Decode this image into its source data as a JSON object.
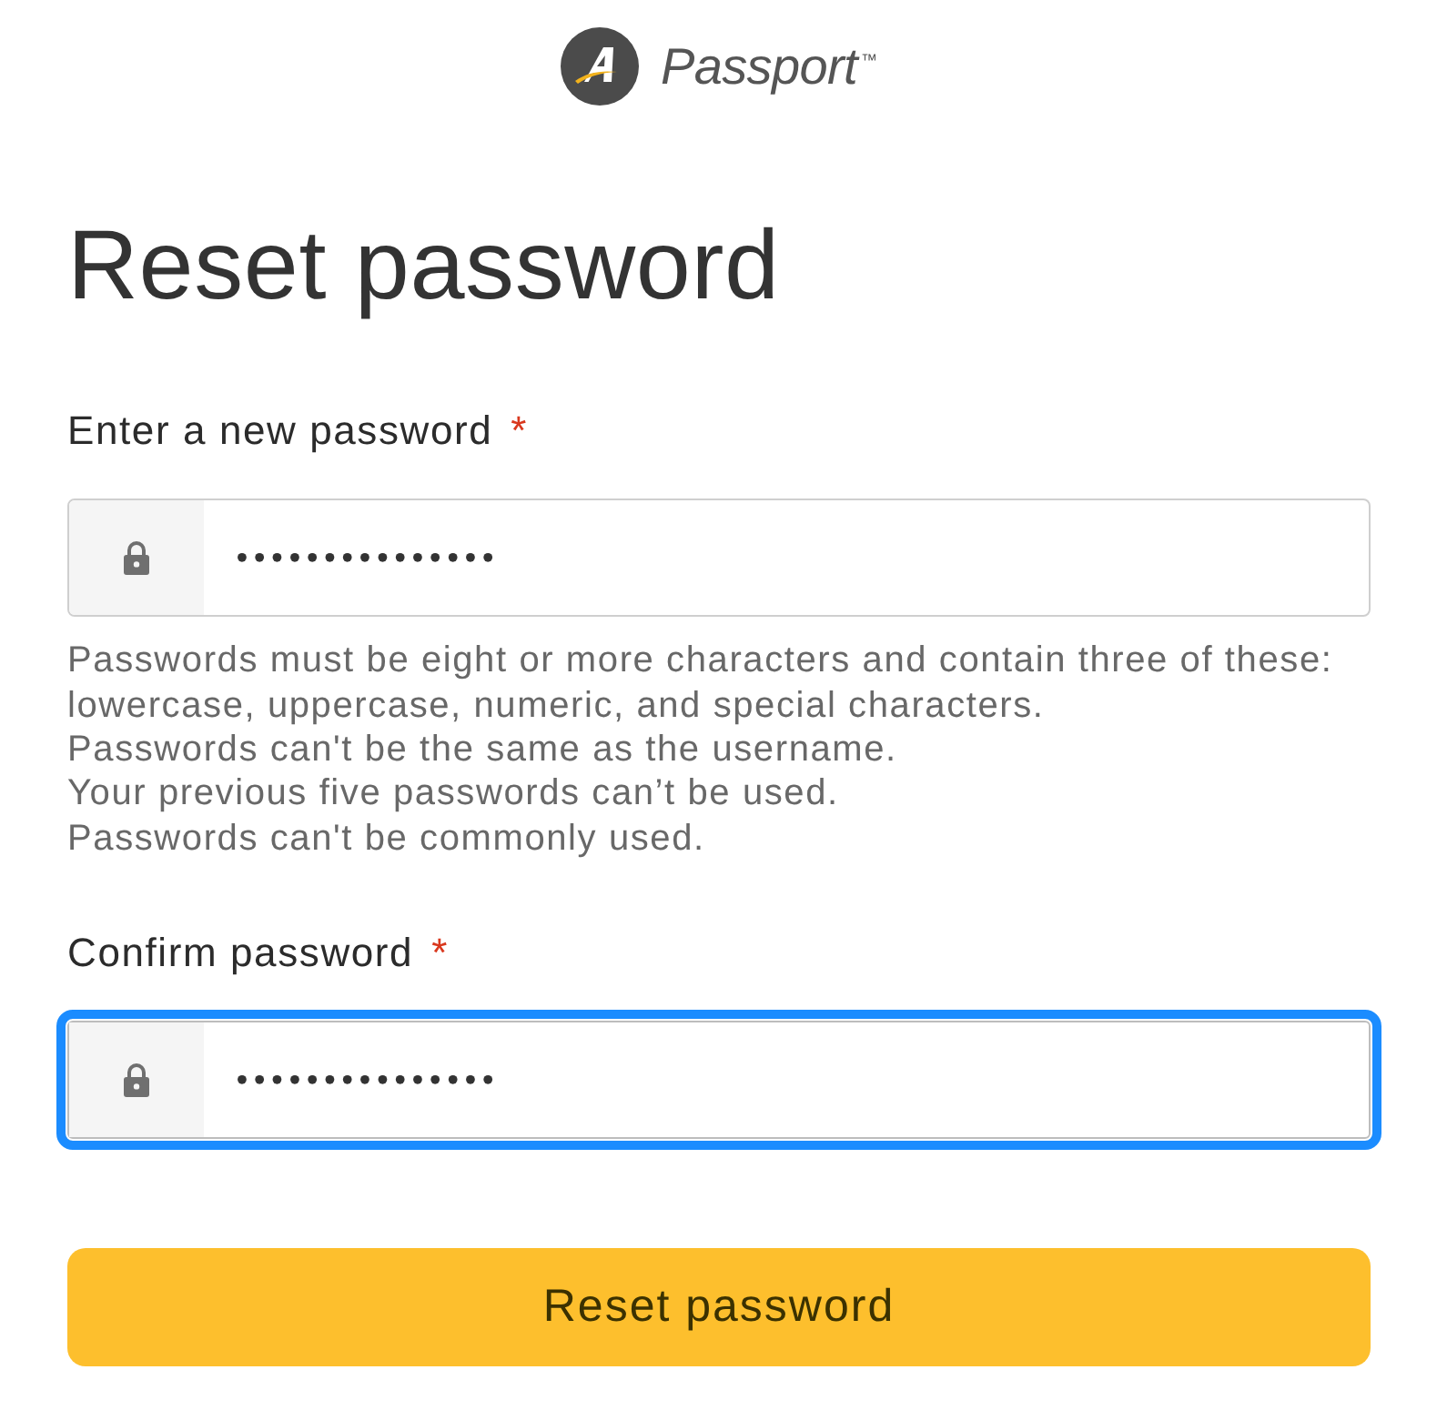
{
  "logo": {
    "name": "Passport",
    "trademark": "™"
  },
  "title": "Reset password",
  "fields": [
    {
      "label": "Enter a new password",
      "required_mark": "*",
      "value": "•••••••••••••••",
      "focused": false,
      "help": [
        "Passwords must be eight or more characters and contain three of these: lowercase, uppercase, numeric, and special characters.",
        "Passwords can't be the same as the username.",
        "Your previous five passwords can’t be used.",
        "Passwords can't be commonly used."
      ]
    },
    {
      "label": "Confirm password",
      "required_mark": "*",
      "value": "•••••••••••••••",
      "focused": true
    }
  ],
  "submit": {
    "label": "Reset password"
  }
}
